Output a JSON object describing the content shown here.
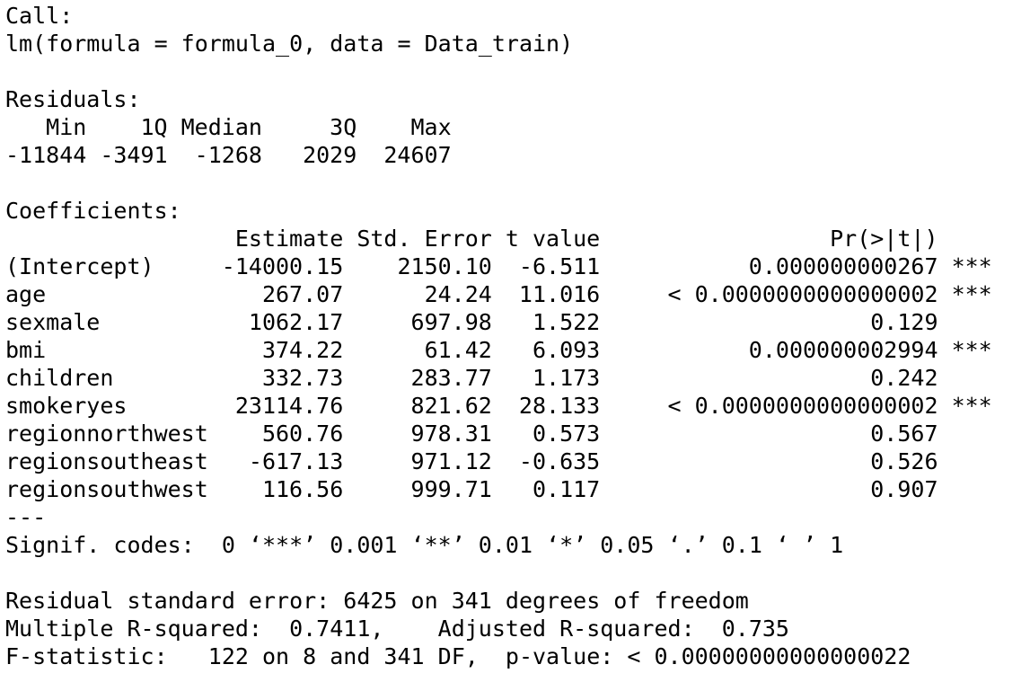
{
  "call": {
    "label": "Call:",
    "formula": "lm(formula = formula_0, data = Data_train)"
  },
  "residuals": {
    "label": "Residuals:",
    "headers": [
      "Min",
      "1Q",
      "Median",
      "3Q",
      "Max"
    ],
    "values": [
      "-11844",
      "-3491",
      "-1268",
      "2029",
      "24607"
    ]
  },
  "coefficients": {
    "label": "Coefficients:",
    "headers": [
      "Estimate",
      "Std. Error",
      "t value",
      "Pr(>|t|)"
    ],
    "rows": [
      {
        "term": "(Intercept)",
        "estimate": "-14000.15",
        "std_error": "2150.10",
        "t_value": "-6.511",
        "p_value": "0.000000000267",
        "signif": "***"
      },
      {
        "term": "age",
        "estimate": "267.07",
        "std_error": "24.24",
        "t_value": "11.016",
        "p_value": "< 0.0000000000000002",
        "signif": "***"
      },
      {
        "term": "sexmale",
        "estimate": "1062.17",
        "std_error": "697.98",
        "t_value": "1.522",
        "p_value": "0.129",
        "signif": ""
      },
      {
        "term": "bmi",
        "estimate": "374.22",
        "std_error": "61.42",
        "t_value": "6.093",
        "p_value": "0.000000002994",
        "signif": "***"
      },
      {
        "term": "children",
        "estimate": "332.73",
        "std_error": "283.77",
        "t_value": "1.173",
        "p_value": "0.242",
        "signif": ""
      },
      {
        "term": "smokeryes",
        "estimate": "23114.76",
        "std_error": "821.62",
        "t_value": "28.133",
        "p_value": "< 0.0000000000000002",
        "signif": "***"
      },
      {
        "term": "regionnorthwest",
        "estimate": "560.76",
        "std_error": "978.31",
        "t_value": "0.573",
        "p_value": "0.567",
        "signif": ""
      },
      {
        "term": "regionsoutheast",
        "estimate": "-617.13",
        "std_error": "971.12",
        "t_value": "-0.635",
        "p_value": "0.526",
        "signif": ""
      },
      {
        "term": "regionsouthwest",
        "estimate": "116.56",
        "std_error": "999.71",
        "t_value": "0.117",
        "p_value": "0.907",
        "signif": ""
      }
    ],
    "separator": "---",
    "signif_codes": "Signif. codes:  0 ‘***’ 0.001 ‘**’ 0.01 ‘*’ 0.05 ‘.’ 0.1 ‘ ’ 1"
  },
  "summary": {
    "residual_se": "Residual standard error: 6425 on 341 degrees of freedom",
    "r_squared": "Multiple R-squared:  0.7411,\tAdjusted R-squared:  0.735 ",
    "f_statistic": "F-statistic:   122 on 8 and 341 DF,  p-value: < 0.00000000000000022"
  }
}
